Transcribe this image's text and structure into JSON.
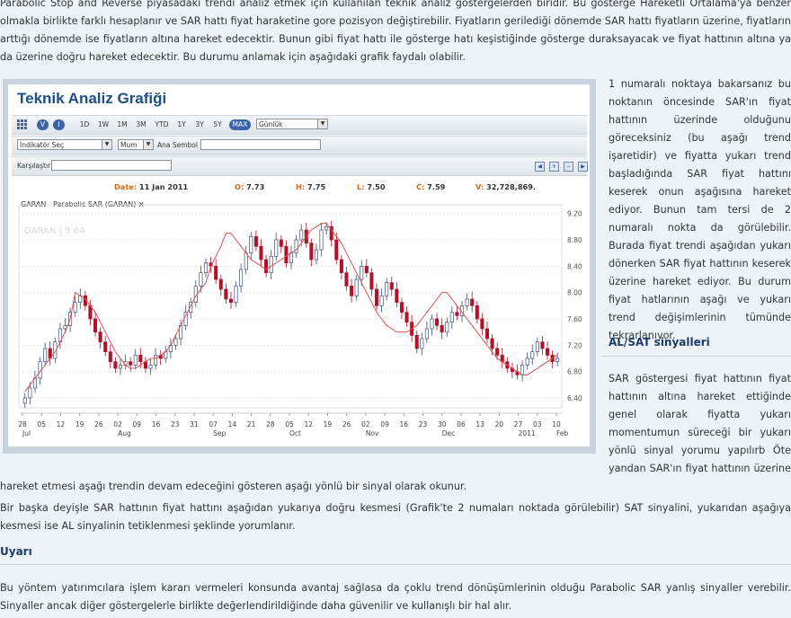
{
  "intro_text": "Parabolic Stop and Reverse piyasadaki trendi analiz etmek için kullanılan teknik analiz göstergelerden biridir. Bu gösterge Hareketli Ortalama'ya benzer olmakla birlikte farklı hesaplanır ve SAR hattı fiyat haraketine gore pozisyon değiştirebilir. Fiyatların gerilediği dönemde SAR hattı fiyatların üzerine, fiyatların arttığı dönemde ise fiyatların altına hareket edecektir. Bunun gibi fiyat hattı ile gösterge hatı keşistiğinde gösterge duraksayacak ve fiyat hattının altına ya da üzerine doğru hareket edecektir. Bu durumu anlamak için aşağıdaki grafik faydalı olabilir.",
  "chart_app": {
    "title": "Teknik Analiz Grafiği",
    "toolbar": {
      "view_buttons": [
        "V",
        "I"
      ],
      "ranges": [
        "1D",
        "1W",
        "1M",
        "3M",
        "YTD",
        "1Y",
        "3Y",
        "5Y",
        "MAX"
      ],
      "active_range": "MAX",
      "interval": "Günlük"
    },
    "indicator_select": "İndikatör Seç",
    "chart_type_select": "Mum",
    "main_symbol_label": "Ana Sembol",
    "compare_label": "Karşılaştır",
    "ohlc": {
      "date_label": "Date:",
      "date": "11 Jan 2011",
      "open_label": "O:",
      "open": "7.73",
      "high_label": "H:",
      "high": "7.75",
      "low_label": "L:",
      "low": "7.50",
      "close_label": "C:",
      "close": "7.59",
      "volume_label": "V:",
      "volume": "32,728,869."
    },
    "series_label": "GARAN   Parabolic SAR (GARAN)",
    "close_x": "×",
    "watermark": "GARAN | 9.64"
  },
  "chart_data": {
    "type": "candlestick",
    "series": [
      {
        "name": "GARAN"
      },
      {
        "name": "Parabolic SAR (GARAN)"
      }
    ],
    "y_ticks": [
      9.2,
      8.8,
      8.4,
      8.0,
      7.6,
      7.2,
      6.8,
      6.4
    ],
    "ylim": [
      6.25,
      9.25
    ],
    "x_day_ticks": [
      "28",
      "05",
      "12",
      "19",
      "26",
      "02",
      "09",
      "16",
      "23",
      "31",
      "07",
      "14",
      "21",
      "28",
      "05",
      "12",
      "19",
      "26",
      "02",
      "09",
      "16",
      "23",
      "30",
      "06",
      "13",
      "20",
      "27",
      "03",
      "10"
    ],
    "x_month_labels": [
      "Jul",
      "Aug",
      "Sep",
      "Oct",
      "Nov",
      "Dec",
      "2011",
      "Feb"
    ],
    "close": [
      6.4,
      6.55,
      6.7,
      6.95,
      7.15,
      7.0,
      7.25,
      7.45,
      7.5,
      7.7,
      7.85,
      7.95,
      7.8,
      7.6,
      7.4,
      7.25,
      7.1,
      6.95,
      6.85,
      6.9,
      6.95,
      6.9,
      7.05,
      6.95,
      6.85,
      6.9,
      7.05,
      7.0,
      7.1,
      7.2,
      7.3,
      7.5,
      7.7,
      7.85,
      8.1,
      8.3,
      8.45,
      8.4,
      8.2,
      8.05,
      7.9,
      7.85,
      8.1,
      8.35,
      8.6,
      8.85,
      8.7,
      8.5,
      8.3,
      8.55,
      8.8,
      8.7,
      8.45,
      8.6,
      8.8,
      8.95,
      8.75,
      8.5,
      8.65,
      8.95,
      9.0,
      8.8,
      8.5,
      8.3,
      8.1,
      7.95,
      8.2,
      8.4,
      8.3,
      8.05,
      7.8,
      7.95,
      8.15,
      8.05,
      7.85,
      7.7,
      7.55,
      7.35,
      7.15,
      7.3,
      7.45,
      7.6,
      7.5,
      7.4,
      7.55,
      7.7,
      7.65,
      7.8,
      7.9,
      7.8,
      7.6,
      7.45,
      7.3,
      7.15,
      7.05,
      6.95,
      6.85,
      6.8,
      6.75,
      6.9,
      7.0,
      7.1,
      7.25,
      7.15,
      7.05,
      6.95,
      7.0
    ],
    "sar": [
      6.5,
      6.6,
      6.7,
      6.8,
      6.9,
      7.0,
      7.1,
      7.25,
      7.4,
      7.6,
      8.0,
      7.95,
      7.9,
      7.8,
      7.7,
      7.55,
      7.4,
      7.25,
      7.1,
      7.0,
      6.9,
      6.85,
      6.85,
      6.9,
      6.95,
      7.0,
      7.0,
      7.05,
      7.1,
      7.2,
      7.35,
      7.5,
      7.65,
      7.8,
      7.95,
      8.05,
      8.15,
      8.4,
      8.55,
      8.7,
      8.9,
      8.9,
      8.8,
      8.7,
      8.6,
      8.5,
      8.45,
      8.4,
      8.35,
      8.4,
      8.45,
      8.5,
      8.55,
      8.6,
      8.65,
      8.75,
      8.85,
      8.95,
      9.0,
      9.05,
      9.05,
      8.95,
      8.85,
      8.75,
      8.6,
      8.45,
      8.3,
      8.15,
      8.0,
      7.85,
      7.7,
      7.6,
      7.5,
      7.45,
      7.4,
      7.4,
      7.4,
      7.45,
      7.5,
      7.6,
      7.7,
      7.8,
      7.9,
      8.0,
      8.0,
      7.9,
      7.8,
      7.7,
      7.6,
      7.5,
      7.4,
      7.3,
      7.2,
      7.1,
      7.0,
      6.95,
      6.9,
      6.85,
      6.8,
      6.75,
      6.75,
      6.8,
      6.85,
      6.9,
      6.95,
      7.0,
      7.05
    ]
  },
  "side_paragraph_1": "1 numaralı noktaya bakarsanız bu noktanın öncesinde SAR'ın fiyat hattının üzerinde olduğunu göreceksiniz (bu aşağı trend işaretidir) ve fiyatta yukarı trend başladığında SAR fiyat hattını keserek onun aşağısına hareket ediyor. Bunun tam tersi de 2 numaralı nokta da görülebilir. Burada fiyat trendi aşağıdan yukarı dönerken SAR fiyat hattının keserek üzerine hareket ediyor. Bu durum fiyat hatlarının aşağı ve yukarı trend değişimlerinin tümünde tekrarlanıyor.",
  "section_title": "AL/SAT sinyalleri",
  "side_paragraph_2": "SAR göstergesi fiyat hattının fiyat hattının altına hareket ettiğinde genel olarak fiyatta yukarı momentumun süreceği bir yukarı yönlü sinyal yorumu yapılırb Öte yandan SAR'ın fiyat hattının üzerine",
  "continuation_text": "hareket etmesi aşağı trendin devam edeceğini gösteren aşağı yönlü bir sinyal olarak okunur.",
  "paragraph_2": "Bir başka deyişle SAR hattının fiyat hattını aşağıdan yukarıya doğru kesmesi (Grafik'te 2 numaları noktada görülebilir) SAT sinyalini, yukarıdan aşağıya kesmesi ise AL sinyalinin tetiklenmesi şeklinde yorumlanır.",
  "warning_title": "Uyarı",
  "paragraph_3": "Bu yöntem yatırımcılara işlem kararı vermeleri konsunda avantaj sağlasa da çoklu trend dönüşümlerinin olduğu Parabolic SAR yanlış sinyaller verebilir. Sinyaller ancak diğer göstergelerle birlikte değerlendirildiğinde daha güvenilir ve kullanışlı bir hal alır.",
  "colors": {
    "up_candle": "#ffffff",
    "up_border": "#3a4f7a",
    "down_candle": "#b0122a",
    "sar_line": "#e05050",
    "heading": "#1b3a66",
    "chart_title": "#1b4f8a"
  }
}
